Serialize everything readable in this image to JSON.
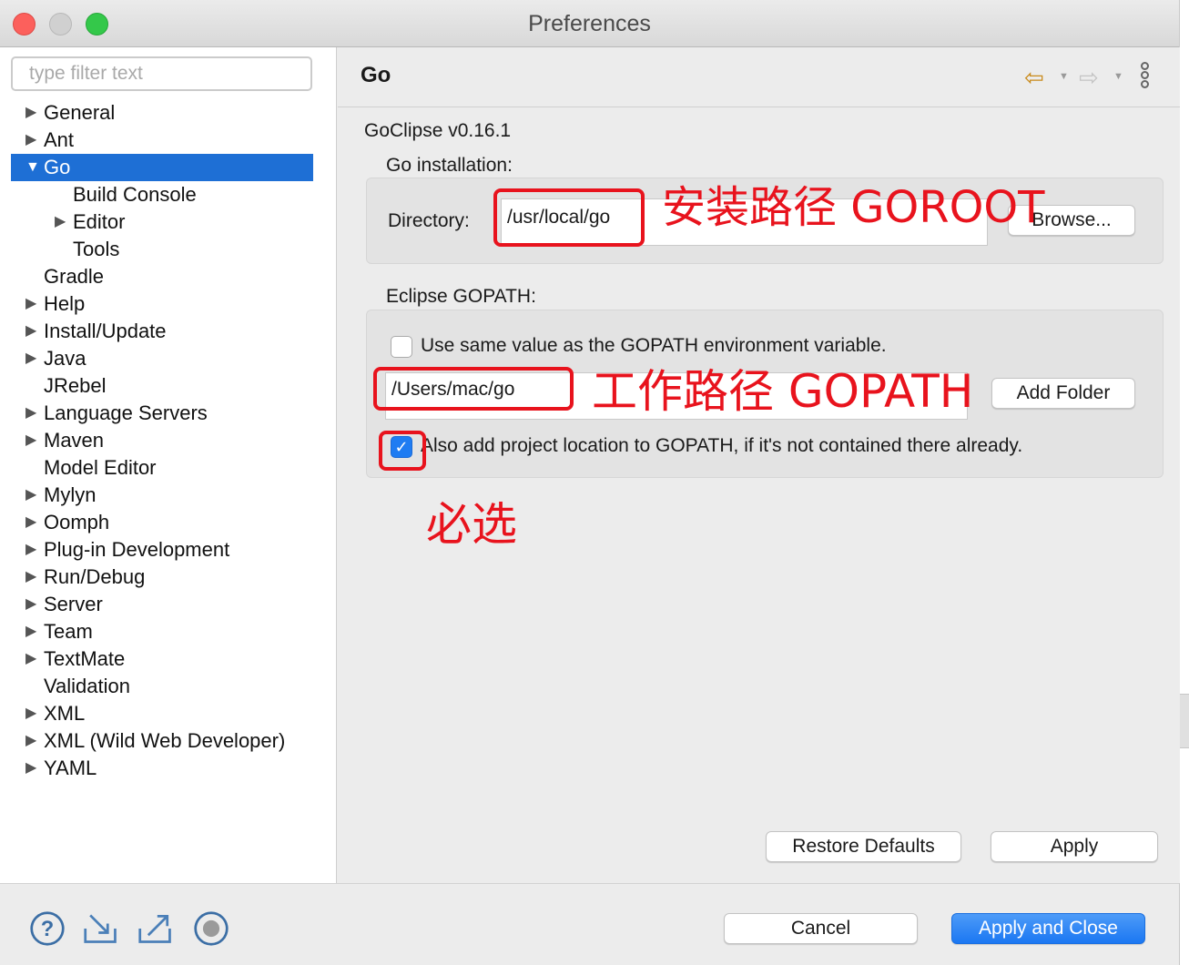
{
  "window": {
    "title": "Preferences"
  },
  "sidebar": {
    "filter_placeholder": "type filter text",
    "items": [
      {
        "label": "General",
        "expandable": true,
        "level": 0
      },
      {
        "label": "Ant",
        "expandable": true,
        "level": 0
      },
      {
        "label": "Go",
        "expandable": true,
        "expanded": true,
        "selected": true,
        "level": 0
      },
      {
        "label": "Build Console",
        "expandable": false,
        "level": 1
      },
      {
        "label": "Editor",
        "expandable": true,
        "level": 1
      },
      {
        "label": "Tools",
        "expandable": false,
        "level": 1
      },
      {
        "label": "Gradle",
        "expandable": false,
        "level": 0
      },
      {
        "label": "Help",
        "expandable": true,
        "level": 0
      },
      {
        "label": "Install/Update",
        "expandable": true,
        "level": 0
      },
      {
        "label": "Java",
        "expandable": true,
        "level": 0
      },
      {
        "label": "JRebel",
        "expandable": false,
        "level": 0
      },
      {
        "label": "Language Servers",
        "expandable": true,
        "level": 0
      },
      {
        "label": "Maven",
        "expandable": true,
        "level": 0
      },
      {
        "label": "Model Editor",
        "expandable": false,
        "level": 0
      },
      {
        "label": "Mylyn",
        "expandable": true,
        "level": 0
      },
      {
        "label": "Oomph",
        "expandable": true,
        "level": 0
      },
      {
        "label": "Plug-in Development",
        "expandable": true,
        "level": 0
      },
      {
        "label": "Run/Debug",
        "expandable": true,
        "level": 0
      },
      {
        "label": "Server",
        "expandable": true,
        "level": 0
      },
      {
        "label": "Team",
        "expandable": true,
        "level": 0
      },
      {
        "label": "TextMate",
        "expandable": true,
        "level": 0
      },
      {
        "label": "Validation",
        "expandable": false,
        "level": 0
      },
      {
        "label": "XML",
        "expandable": true,
        "level": 0
      },
      {
        "label": "XML (Wild Web Developer)",
        "expandable": true,
        "level": 0
      },
      {
        "label": "YAML",
        "expandable": true,
        "level": 0
      }
    ]
  },
  "page": {
    "title": "Go",
    "version": "GoClipse v0.16.1",
    "go_installation": {
      "label": "Go installation:",
      "directory_label": "Directory:",
      "directory_value": "/usr/local/go",
      "browse_button": "Browse..."
    },
    "gopath": {
      "label": "Eclipse GOPATH:",
      "use_env_label": "Use same value as the GOPATH environment variable.",
      "use_env_checked": false,
      "path_value": "/Users/mac/go",
      "add_folder_button": "Add Folder",
      "also_add_label": "Also add project location to GOPATH, if it's not contained there already.",
      "also_add_checked": true
    },
    "restore_defaults_button": "Restore Defaults",
    "apply_button": "Apply"
  },
  "annotations": {
    "goroot_note": "安装路径 GOROOT",
    "gopath_note": "工作路径 GOPATH",
    "required_note": "必选",
    "color": "#e8131d"
  },
  "footer": {
    "cancel_button": "Cancel",
    "apply_close_button": "Apply and Close"
  },
  "colors": {
    "selection": "#1e6fd5",
    "primary_button": "#1b77f2"
  }
}
